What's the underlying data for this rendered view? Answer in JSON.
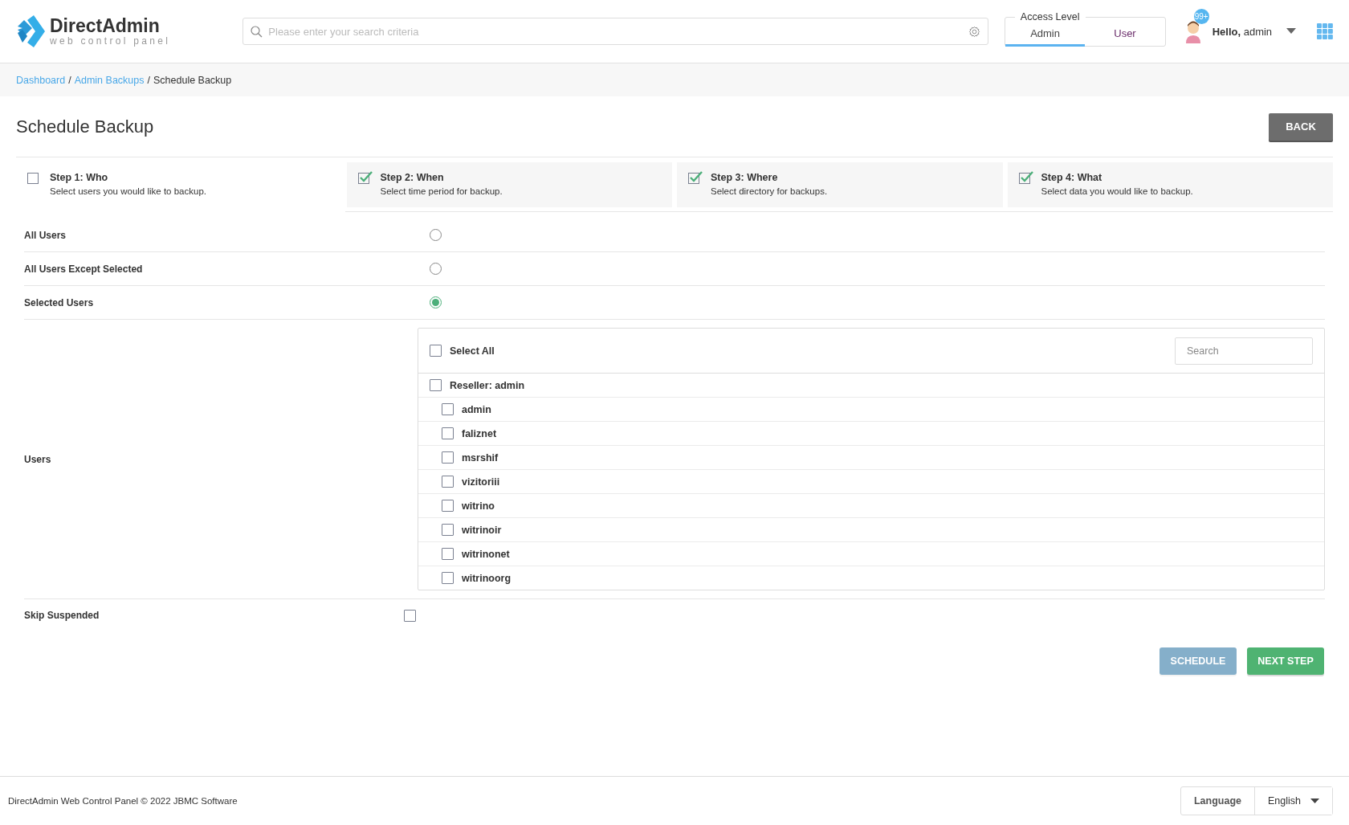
{
  "logo": {
    "name": "DirectAdmin",
    "tagline": "web control panel"
  },
  "search": {
    "placeholder": "Please enter your search criteria"
  },
  "access_level": {
    "label": "Access Level",
    "options": [
      {
        "label": "Admin",
        "selected": true
      },
      {
        "label": "User",
        "selected": false
      }
    ]
  },
  "user": {
    "badge": "99+",
    "greeting": "Hello,",
    "name": "admin"
  },
  "breadcrumb": [
    {
      "label": "Dashboard",
      "link": true
    },
    {
      "label": "Admin Backups",
      "link": true
    },
    {
      "label": "Schedule Backup",
      "link": false
    }
  ],
  "breadcrumb_separator": "/",
  "page_title": "Schedule Backup",
  "back_button": "BACK",
  "steps": [
    {
      "title": "Step 1: Who",
      "description": "Select users you would like to backup.",
      "done": false
    },
    {
      "title": "Step 2: When",
      "description": "Select time period for backup.",
      "done": true
    },
    {
      "title": "Step 3: Where",
      "description": "Select directory for backups.",
      "done": true
    },
    {
      "title": "Step 4: What",
      "description": "Select data you would like to backup.",
      "done": true
    }
  ],
  "scope": [
    {
      "label": "All Users",
      "selected": false
    },
    {
      "label": "All Users Except Selected",
      "selected": false
    },
    {
      "label": "Selected Users",
      "selected": true
    }
  ],
  "users": {
    "label": "Users",
    "select_all": {
      "label": "Select All",
      "checked": false
    },
    "search_placeholder": "Search",
    "tree": [
      {
        "label": "Reseller: admin",
        "checked": false,
        "children": [
          {
            "label": "admin",
            "checked": false
          },
          {
            "label": "faliznet",
            "checked": false
          },
          {
            "label": "msrshif",
            "checked": false
          },
          {
            "label": "vizitoriii",
            "checked": false
          },
          {
            "label": "witrino",
            "checked": false
          },
          {
            "label": "witrinoir",
            "checked": false
          },
          {
            "label": "witrinonet",
            "checked": false
          },
          {
            "label": "witrinoorg",
            "checked": false
          }
        ]
      }
    ]
  },
  "skip_suspended": {
    "label": "Skip Suspended",
    "checked": false
  },
  "buttons": [
    {
      "label": "SCHEDULE",
      "kind": "info",
      "disabled": true
    },
    {
      "label": "NEXT STEP",
      "kind": "success",
      "disabled": false
    }
  ],
  "footer": {
    "copyright": "DirectAdmin Web Control Panel © 2022 JBMC Software",
    "language_label": "Language",
    "language": "English"
  }
}
